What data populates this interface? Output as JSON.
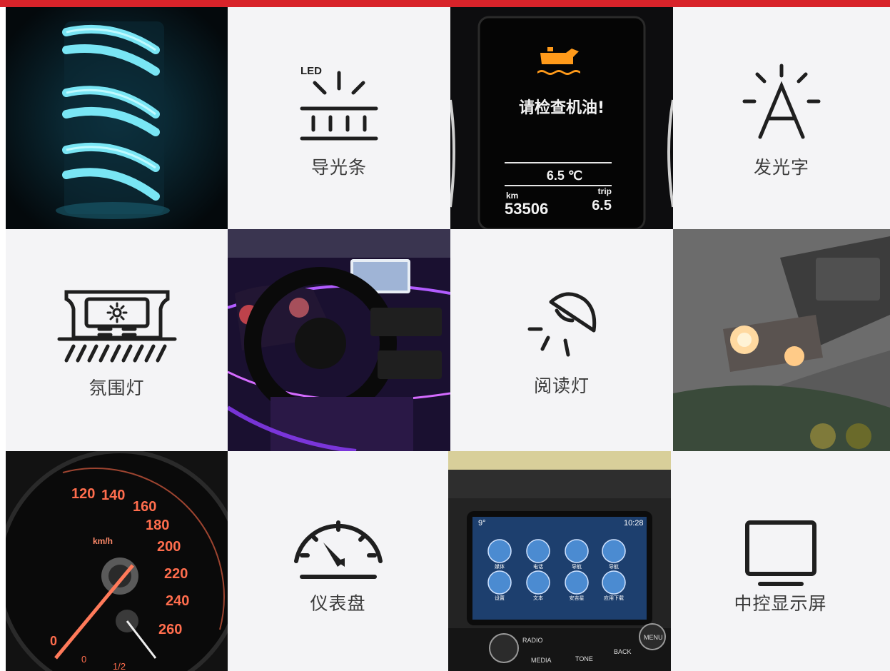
{
  "categories": [
    {
      "id": "light-strip",
      "label": "导光条",
      "icon": "led-strip-icon",
      "badge": "LED"
    },
    {
      "id": "luminous-letter",
      "label": "发光字",
      "icon": "glowing-letter-icon",
      "letter": "A"
    },
    {
      "id": "ambient-light",
      "label": "氛围灯",
      "icon": "ambient-light-icon"
    },
    {
      "id": "reading-light",
      "label": "阅读灯",
      "icon": "reading-lamp-icon"
    },
    {
      "id": "instrument-panel",
      "label": "仪表盘",
      "icon": "gauge-icon"
    },
    {
      "id": "center-display",
      "label": "中控显示屏",
      "icon": "monitor-icon"
    }
  ],
  "dashboard_photo": {
    "warning_text": "请检查机油!",
    "temperature": "6.5 ℃",
    "odometer_unit": "km",
    "odometer_value": "53506",
    "trip_unit": "trip",
    "trip_value": "6.5"
  },
  "speedometer_photo": {
    "unit": "km/h",
    "ticks": [
      "0",
      "120",
      "140",
      "160",
      "180",
      "200",
      "220",
      "240",
      "260"
    ],
    "fuel_marks": [
      "0",
      "1/2"
    ]
  },
  "infotainment_photo": {
    "temp": "9°",
    "time": "10:28",
    "apps": [
      "媒体",
      "电话",
      "导航",
      "导航",
      "设置",
      "文本",
      "安吉星",
      "应用下载"
    ],
    "buttons": [
      "RADIO",
      "MEDIA",
      "TONE",
      "BACK",
      "MENU"
    ]
  },
  "colors": {
    "accent_bar": "#d8232a",
    "tile_background": "#f4f4f6",
    "icon_color": "#1f1f1f",
    "glow_cyan": "#5fe6ff",
    "warning_orange": "#ff9a1a",
    "ambient_purple": "#9b3cff"
  }
}
